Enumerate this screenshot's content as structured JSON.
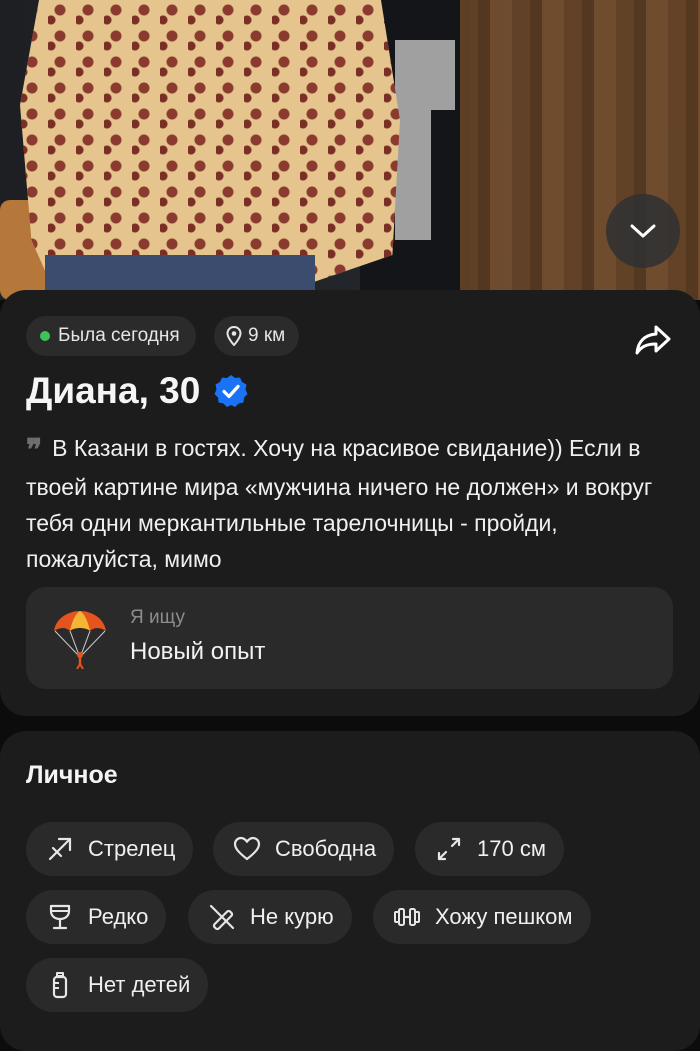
{
  "profile": {
    "status": "Была сегодня",
    "distance": "9 км",
    "name_age": "Диана, 30",
    "about": "В Казани в гостях. Хочу на красивое свидание)) Если в твоей картине мира «мужчина ничего не должен» и вокруг тебя одни меркантильные тарелочницы - пройди, пожалуйста, мимо",
    "looking_for": {
      "label": "Я ищу",
      "value": "Новый опыт"
    }
  },
  "personal": {
    "title": "Личное",
    "tags": [
      {
        "icon": "sagittarius-icon",
        "label": "Стрелец"
      },
      {
        "icon": "heart-icon",
        "label": "Свободна"
      },
      {
        "icon": "height-icon",
        "label": "170 см"
      },
      {
        "icon": "wine-glass-icon",
        "label": "Редко"
      },
      {
        "icon": "no-smoking-icon",
        "label": "Не курю"
      },
      {
        "icon": "dumbbell-icon",
        "label": "Хожу пешком"
      },
      {
        "icon": "baby-bottle-icon",
        "label": "Нет детей"
      }
    ]
  },
  "colors": {
    "online": "#3cc45a",
    "verified": "#1a73f5",
    "card": "#1c1c1c",
    "pill": "#2b2b2b"
  }
}
